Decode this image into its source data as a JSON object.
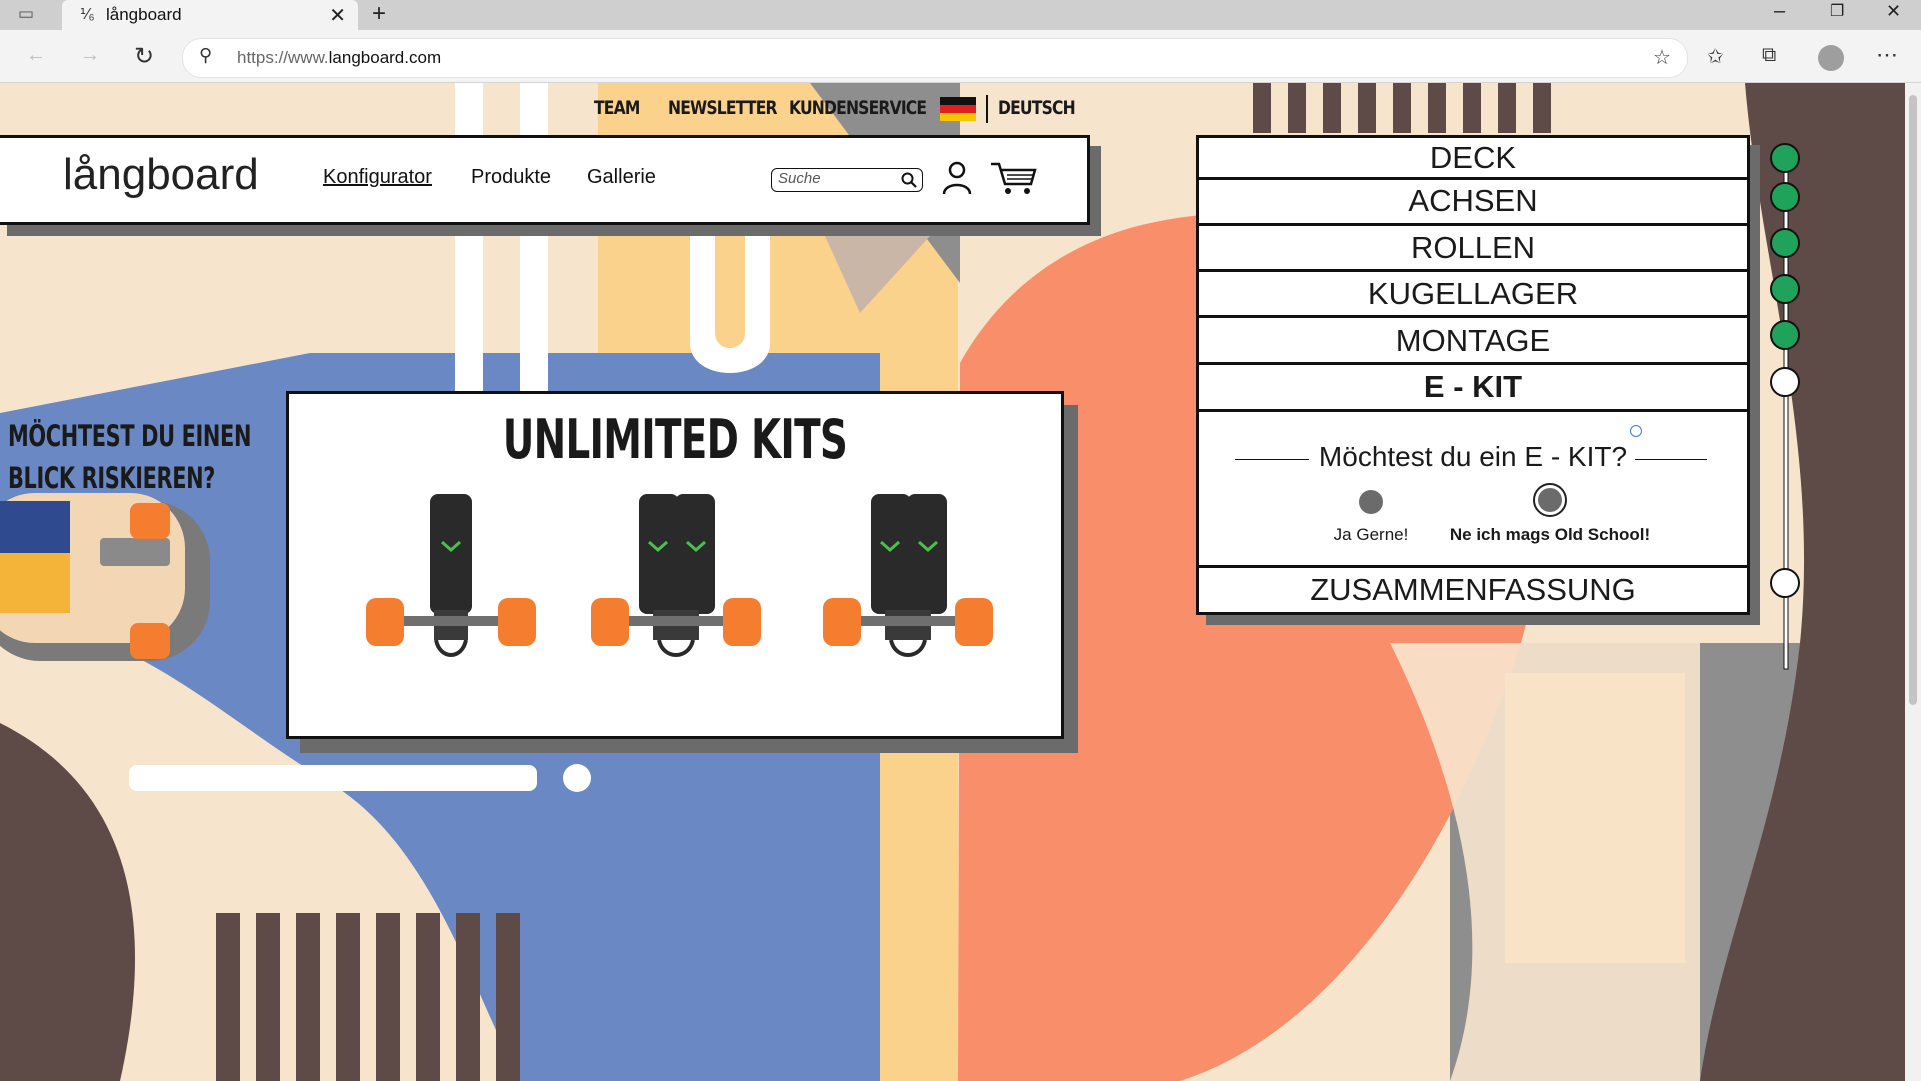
{
  "browser": {
    "tab_title": "långboard",
    "url_prefix": "https://www.",
    "url_domain": "langboard.com"
  },
  "topnav": {
    "team": "TEAM",
    "newsletter": "NEWSLETTER",
    "kundenservice": "KUNDENSERVICE",
    "language": "DEUTSCH"
  },
  "header": {
    "logo": "långboard",
    "nav": [
      "Konfigurator",
      "Produkte",
      "Gallerie"
    ],
    "search_placeholder": "Suche"
  },
  "teaser": {
    "line1": "MÖCHTEST DU EINEN",
    "line2": "BLICK RISKIEREN?"
  },
  "kits": {
    "title": "UNLIMITED KITS"
  },
  "configurator": {
    "steps": [
      "DECK",
      "ACHSEN",
      "ROLLEN",
      "KUGELLAGER",
      "MONTAGE",
      "E - KIT"
    ],
    "question": "Möchtest du ein E - KIT?",
    "options": [
      "Ja Gerne!",
      "Ne ich mags Old School!"
    ],
    "selected_option": 1,
    "summary": "ZUSAMMENFASSUNG",
    "completed_steps": 5
  },
  "colors": {
    "step_done": "#1fa35a",
    "accent_orange": "#f98f6a",
    "accent_blue": "#6a88c4",
    "accent_yellow": "#fbd28c",
    "accent_grey": "#8e8e8e"
  }
}
